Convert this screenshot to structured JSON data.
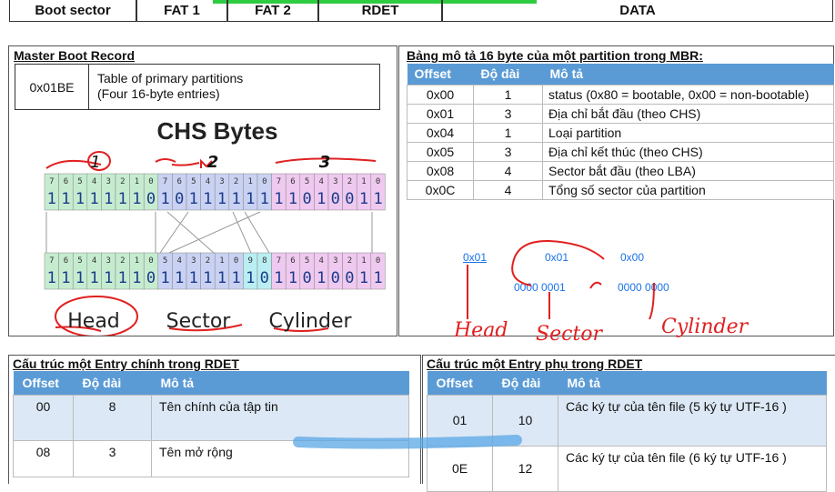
{
  "topbar": {
    "segments": [
      "Boot sector",
      "FAT 1",
      "FAT 2",
      "RDET",
      "DATA"
    ]
  },
  "mbr": {
    "title": "Master Boot Record",
    "offset": "0x01BE",
    "desc_line1": "Table of primary partitions",
    "desc_line2": "(Four 16-byte entries)"
  },
  "chs": {
    "title": "CHS Bytes",
    "row1_bits": "111111101011111111010011",
    "row1_idx": [
      "7",
      "6",
      "5",
      "4",
      "3",
      "2",
      "1",
      "0",
      "7",
      "6",
      "5",
      "4",
      "3",
      "2",
      "1",
      "0",
      "7",
      "6",
      "5",
      "4",
      "3",
      "2",
      "1",
      "0"
    ],
    "row2_bits": "111111101111111011010011",
    "row2_idx": [
      "7",
      "6",
      "5",
      "4",
      "3",
      "2",
      "1",
      "0",
      "5",
      "4",
      "3",
      "2",
      "1",
      "0",
      "9",
      "8",
      "7",
      "6",
      "5",
      "4",
      "3",
      "2",
      "1",
      "0"
    ],
    "label_head": "Head",
    "label_sector": "Sector",
    "label_cylinder": "Cylinder",
    "hand_1": "1",
    "hand_2": "2",
    "hand_3": "3"
  },
  "partition": {
    "title": "Bảng mô tả 16 byte của một partition trong MBR:",
    "headers": [
      "Offset",
      "Độ dài",
      "Mô tả"
    ],
    "rows": [
      [
        "0x00",
        "1",
        "status (0x80 = bootable, 0x00 = non-bootable)"
      ],
      [
        "0x01",
        "3",
        "Địa chỉ bắt đầu (theo CHS)"
      ],
      [
        "0x04",
        "1",
        "Loại partition"
      ],
      [
        "0x05",
        "3",
        "Địa chỉ kết thúc (theo CHS)"
      ],
      [
        "0x08",
        "4",
        "Sector bắt đầu (theo LBA)"
      ],
      [
        "0x0C",
        "4",
        "Tổng số sector của partition"
      ]
    ]
  },
  "annotations": {
    "a1": "0x01",
    "a2": "0x01",
    "a3": "0x00",
    "a4": "0000 0001",
    "a5": "0000 0000",
    "hw_head": "Head",
    "hw_sector": "Sector",
    "hw_cylinder": "Cylinder"
  },
  "rdet_main": {
    "title": "Cấu trúc một Entry chính  trong RDET",
    "headers": [
      "Offset",
      "Độ dài",
      "Mô tả"
    ],
    "rows": [
      [
        "00",
        "8",
        "Tên chính của tập tin"
      ],
      [
        "08",
        "3",
        "Tên mở rộng"
      ]
    ]
  },
  "rdet_sub": {
    "title": "Cấu trúc một Entry phụ trong RDET",
    "headers": [
      "Offset",
      "Độ dài",
      "Mô tả"
    ],
    "rows": [
      [
        "01",
        "10",
        "Các ký tự của tên file (5 ký tự UTF-16 )"
      ],
      [
        "0E",
        "12",
        "Các ký tự của tên file (6 ký tự UTF-16 )"
      ]
    ]
  }
}
